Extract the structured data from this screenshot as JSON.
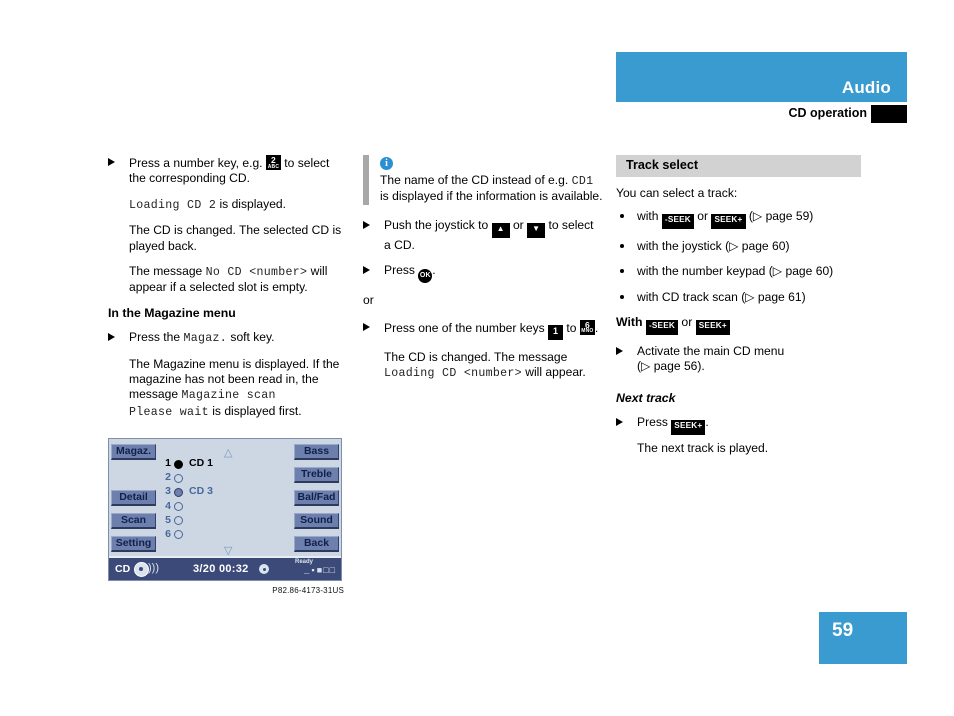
{
  "header": {
    "title": "Audio",
    "subtitle": "CD operation"
  },
  "page_number": "59",
  "left_column": {
    "step1": {
      "text_before": "Press a number key, e.g.",
      "key": {
        "number": "2",
        "letters": "ABC"
      },
      "text_after": "to select the corresponding CD."
    },
    "display_msg_1": "Loading CD 2",
    "display_msg_1_suffix": "is displayed.",
    "para1": "The CD is changed. The selected CD is played back.",
    "para2_prefix": "The message",
    "para2_mono": "No CD <number>",
    "para2_suffix": "will appear if a selected slot is empty.",
    "subhead": "In the Magazine menu",
    "step2_prefix": "Press the",
    "step2_mono": "Magaz.",
    "step2_suffix": "soft key.",
    "para3_prefix": "The Magazine menu is displayed. If the magazine has not been read in, the message",
    "para3_mono_line1": "Magazine scan",
    "para3_mono_line2": "Please wait",
    "para3_suffix": "is displayed first."
  },
  "figure": {
    "caption": "P82.86-4173-31US",
    "softkeys_left": [
      "Magaz.",
      "Detail",
      "Scan",
      "Setting"
    ],
    "softkeys_right": [
      "Bass",
      "Treble",
      "Bal/Fad",
      "Sound",
      "Back"
    ],
    "scroll_up": "△",
    "scroll_down": "▽",
    "slots": [
      {
        "num": "1",
        "label": "CD 1",
        "state": "filled"
      },
      {
        "num": "2",
        "label": "",
        "state": "empty"
      },
      {
        "num": "3",
        "label": "CD 3",
        "state": "selected"
      },
      {
        "num": "4",
        "label": "",
        "state": "empty"
      },
      {
        "num": "5",
        "label": "",
        "state": "empty"
      },
      {
        "num": "6",
        "label": "",
        "state": "empty"
      }
    ],
    "status": {
      "source": "CD",
      "track": "3/20",
      "time": "00:32",
      "ready": "Ready",
      "levels": "_▪■□□"
    }
  },
  "mid_column": {
    "note": {
      "icon": "i",
      "text_before": "The name of the CD instead of e.g.",
      "mono": "CD1",
      "text_after": "is displayed if the information is available."
    },
    "step_joystick": {
      "prefix": "Push the joystick to",
      "key_up": "▲",
      "middle": "or",
      "key_down": "▼",
      "suffix": "to select a CD."
    },
    "step_ok_prefix": "Press",
    "step_ok_key": "OK",
    "step_ok_suffix": ".",
    "or_label": "or",
    "step_numkeys": {
      "prefix": "Press one of the number keys",
      "key1": {
        "number": "1",
        "letters": ""
      },
      "middle": "to",
      "key6": {
        "number": "6",
        "letters": "MNO"
      },
      "suffix": "."
    },
    "para_result_1": "The CD is changed. The message",
    "para_result_mono": "Loading CD <number>",
    "para_result_2": "will appear."
  },
  "right_column": {
    "section_title": "Track select",
    "intro": "You can select a track:",
    "bullets": [
      {
        "prefix": "with",
        "key_a": "-SEEK",
        "middle": "or",
        "key_b": "SEEK+",
        "ref": "(▷ page 59)"
      },
      {
        "prefix": "with the joystick",
        "ref": "(▷ page 60)"
      },
      {
        "prefix": "with the number keypad",
        "ref": "(▷ page 60)"
      },
      {
        "prefix": "with CD track scan",
        "ref": "(▷ page 61)"
      }
    ],
    "subhead_with": {
      "prefix": "With",
      "key_a": "-SEEK",
      "middle": "or",
      "key_b": "SEEK+"
    },
    "step_activate": "Activate the main CD menu",
    "step_activate_ref": "(▷ page 56).",
    "subhead_next_track": "Next track",
    "step_press_prefix": "Press",
    "step_press_key": "SEEK+",
    "step_press_suffix": ".",
    "para_next": "The next track is played."
  },
  "colors": {
    "accent_blue": "#3a9bd0",
    "section_gray": "#d2d2d2",
    "display_bg": "#cdd7e4",
    "softkey_blue": "#6d80ad",
    "statusbar_navy": "#3b4a78"
  }
}
